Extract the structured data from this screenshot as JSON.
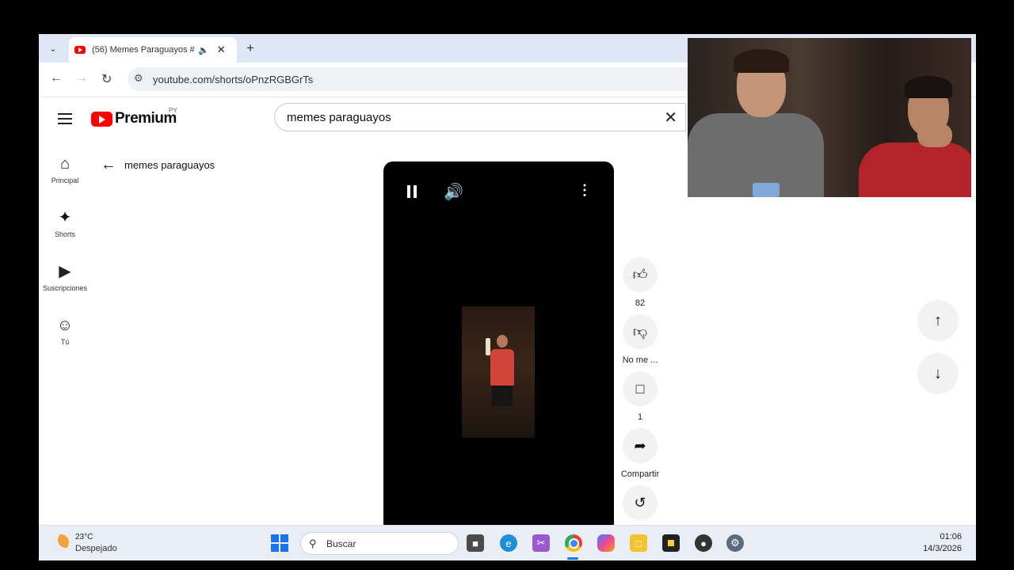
{
  "browser": {
    "tab_title": "(56) Memes Paraguayos #h",
    "url": "youtube.com/shorts/oPnzRGBGrTs"
  },
  "youtube": {
    "brand": "Premium",
    "country": "PY",
    "search_value": "memes paraguayos",
    "back_label": "memes paraguayos",
    "sidebar": [
      {
        "label": "Principal",
        "icon": "home-icon"
      },
      {
        "label": "Shorts",
        "icon": "shorts-icon"
      },
      {
        "label": "Suscripciones",
        "icon": "subscriptions-icon"
      },
      {
        "label": "Tú",
        "icon": "you-icon"
      }
    ],
    "actions": {
      "like_count": "82",
      "dislike_label": "No me ...",
      "comment_count": "1",
      "share_label": "Compartir"
    }
  },
  "taskbar": {
    "temperature": "23°C",
    "condition": "Despejado",
    "search_placeholder": "Buscar",
    "time": "01:06",
    "date": "14/3/2026"
  },
  "colors": {
    "youtube_red": "#ff0000",
    "tabstrip": "#dfe6f5",
    "taskbar": "#e9eef6"
  }
}
